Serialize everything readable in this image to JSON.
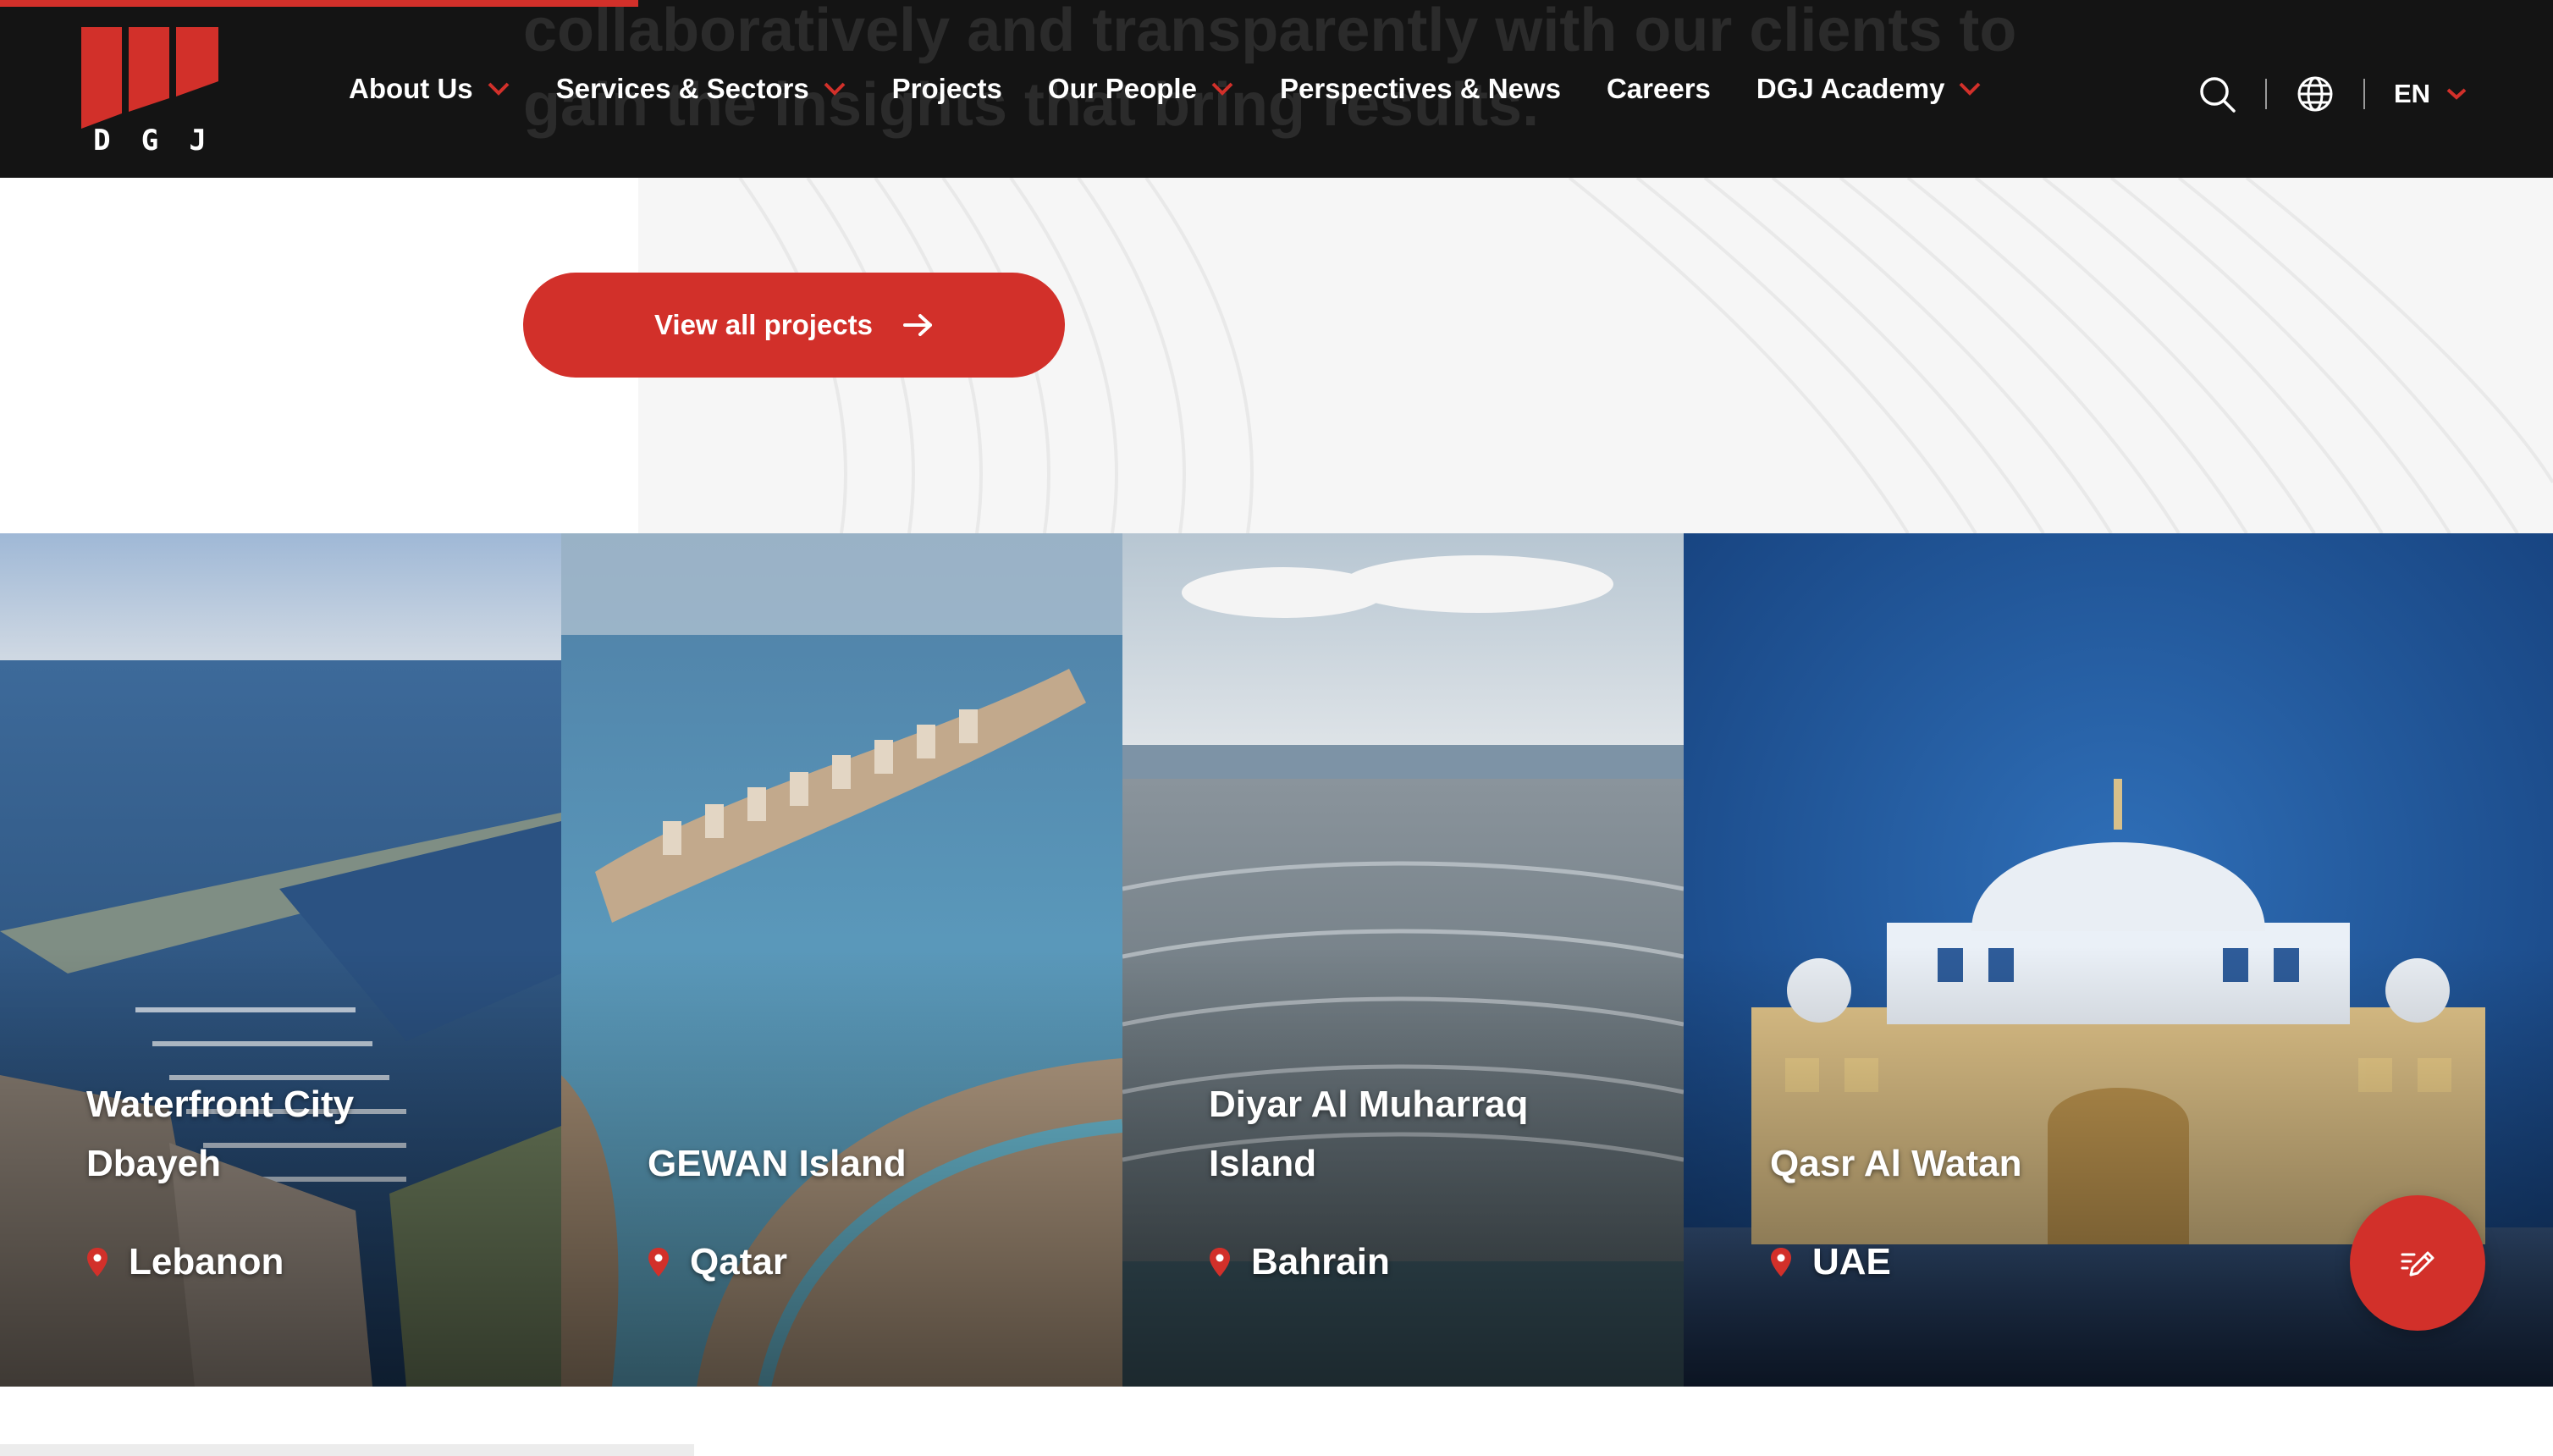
{
  "header": {
    "background_heading": "exactly what they need – which means working\ncollaboratively and transparently with our clients to\ngain the insights that bring results.",
    "scroll_progress": 0.25,
    "logo": {
      "letters": [
        "D",
        "G",
        "J"
      ],
      "color": "#d2302a"
    },
    "nav": [
      {
        "label": "About Us",
        "has_dropdown": true
      },
      {
        "label": "Services & Sectors",
        "has_dropdown": true
      },
      {
        "label": "Projects",
        "has_dropdown": false
      },
      {
        "label": "Our People",
        "has_dropdown": true
      },
      {
        "label": "Perspectives & News",
        "has_dropdown": false
      },
      {
        "label": "Careers",
        "has_dropdown": false
      },
      {
        "label": "DGJ Academy",
        "has_dropdown": true
      }
    ],
    "tools": {
      "search_icon": "search-icon",
      "globe_icon": "globe-icon",
      "language": "EN"
    }
  },
  "hero": {
    "cta_label": "View all projects",
    "cta_icon": "arrow-right-icon"
  },
  "projects": [
    {
      "title": "Waterfront City Dbayeh",
      "location": "Lebanon",
      "theme": "marina"
    },
    {
      "title": "GEWAN Island",
      "location": "Qatar",
      "theme": "island"
    },
    {
      "title": "Diyar Al Muharraq Island",
      "location": "Bahrain",
      "theme": "city"
    },
    {
      "title": "Qasr Al Watan",
      "location": "UAE",
      "theme": "palace"
    }
  ],
  "fab": {
    "icon": "edit-note-icon"
  },
  "colors": {
    "accent": "#d2302a",
    "header_bg": "#141414",
    "text_light": "#ffffff"
  }
}
